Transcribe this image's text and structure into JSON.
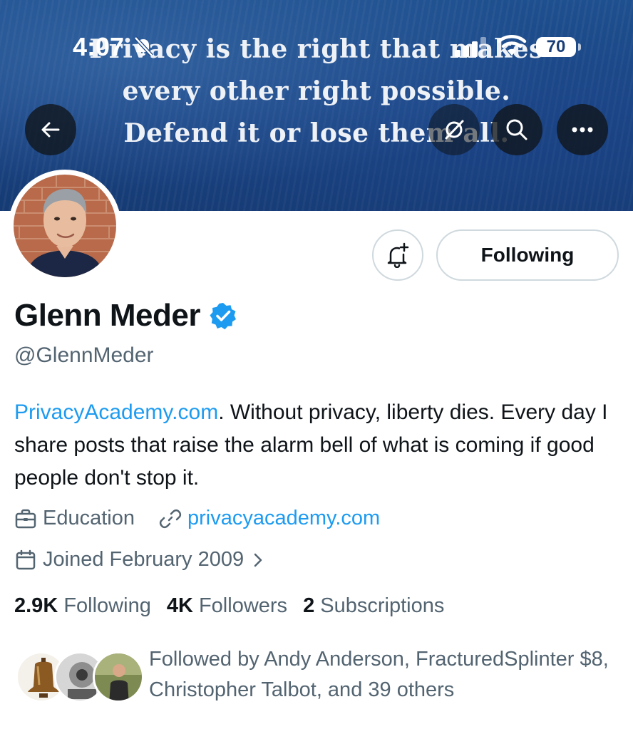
{
  "status_bar": {
    "time": "4:07",
    "battery": "70"
  },
  "banner": {
    "quote_lines": [
      "Privacy is the right that makes",
      "every other right possible.",
      "Defend it or lose them all."
    ]
  },
  "header_buttons": {
    "back_icon": "arrow-left-icon",
    "hide_icon": "eye-slash-icon",
    "search_icon": "search-icon",
    "more_icon": "more-horizontal-icon"
  },
  "profile": {
    "display_name": "Glenn Meder",
    "handle": "@GlennMeder",
    "follow_button_label": "Following",
    "bio_link": "PrivacyAcademy.com",
    "bio_text": ". Without privacy, liberty dies. Every day I share posts that raise the alarm bell of what is coming if good people don't stop it.",
    "category": "Education",
    "website": "privacyacademy.com",
    "joined": "Joined February 2009"
  },
  "stats": {
    "following_count": "2.9K",
    "following_label": "Following",
    "followers_count": "4K",
    "followers_label": "Followers",
    "subscriptions_count": "2",
    "subscriptions_label": "Subscriptions"
  },
  "followed_by": {
    "text": "Followed by Andy Anderson, FracturedSplinter $8, Christopher Talbot, and 39 others"
  },
  "colors": {
    "accent": "#1d9bf0",
    "secondary_text": "#536471",
    "banner_blue": "#1a4585"
  }
}
